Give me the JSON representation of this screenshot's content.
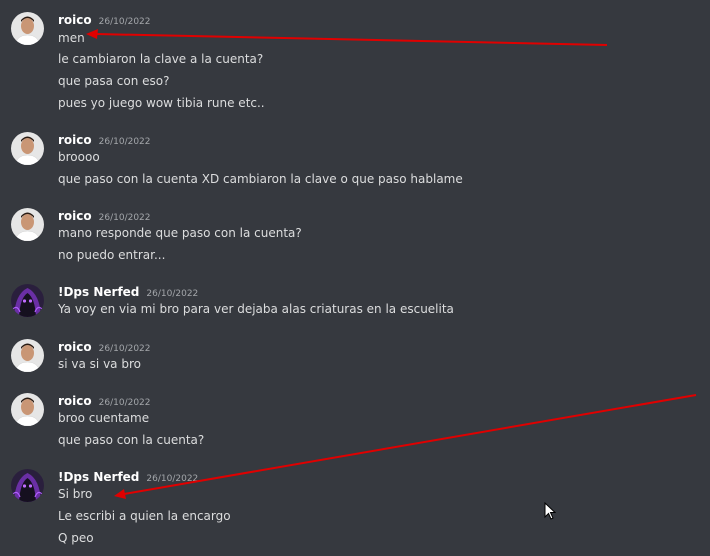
{
  "messages": [
    {
      "author": "roico",
      "timestamp": "26/10/2022",
      "avatar": "person-avatar",
      "lines": [
        "men",
        "le cambiaron la clave a la cuenta?",
        "que pasa con eso?",
        "pues yo juego wow tibia rune etc.."
      ]
    },
    {
      "author": "roico",
      "timestamp": "26/10/2022",
      "avatar": "person-avatar",
      "lines": [
        "broooo",
        "que paso con la cuenta XD cambiaron la clave o que paso hablame"
      ]
    },
    {
      "author": "roico",
      "timestamp": "26/10/2022",
      "avatar": "person-avatar",
      "lines": [
        "mano responde que paso con la cuenta?",
        "no puedo entrar..."
      ]
    },
    {
      "author": "!Dps Nerfed",
      "timestamp": "26/10/2022",
      "avatar": "hooded-figure-avatar",
      "lines": [
        "Ya voy en via mi bro para ver dejaba  alas criaturas en la escuelita"
      ]
    },
    {
      "author": "roico",
      "timestamp": "26/10/2022",
      "avatar": "person-avatar",
      "lines": [
        "si va si va bro"
      ]
    },
    {
      "author": "roico",
      "timestamp": "26/10/2022",
      "avatar": "person-avatar",
      "lines": [
        "broo cuentame",
        "que paso con la cuenta?"
      ]
    },
    {
      "author": "!Dps Nerfed",
      "timestamp": "26/10/2022",
      "avatar": "hooded-figure-avatar",
      "lines": [
        "Si bro",
        "Le escribi a quien la encargo",
        "Q peo"
      ]
    }
  ],
  "annotations": {
    "arrow_color": "#e00000"
  },
  "colors": {
    "background": "#36393f",
    "username": "#ffffff",
    "timestamp": "#a3a6aa",
    "message_text": "#dcddde"
  }
}
